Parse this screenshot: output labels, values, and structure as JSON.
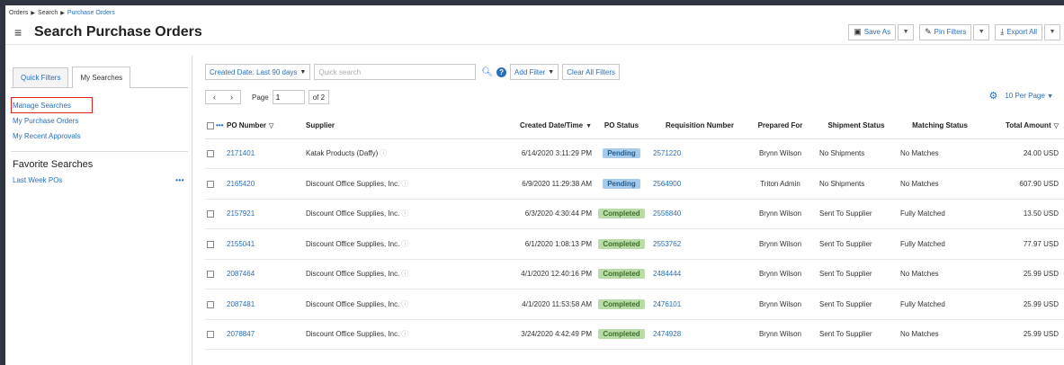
{
  "breadcrumb": [
    "Orders",
    "Search",
    "Purchase Orders"
  ],
  "header": {
    "title": "Search Purchase Orders",
    "save_as": "Save As",
    "pin_filters": "Pin Filters",
    "export_all": "Export All"
  },
  "sidebar": {
    "tabs": [
      "Quick Filters",
      "My Searches"
    ],
    "links": [
      "Manage Searches",
      "My Purchase Orders",
      "My Recent Approvals"
    ],
    "favorites_title": "Favorite Searches",
    "favorites": [
      "Last Week POs"
    ]
  },
  "filters": {
    "date_filter": "Created Date: Last 90 days",
    "search_placeholder": "Quick search",
    "add_filter": "Add Filter",
    "clear_all": "Clear All Filters"
  },
  "pager": {
    "page_label": "Page",
    "page_value": "1",
    "of": "of 2",
    "per_page": "10 Per Page"
  },
  "table": {
    "columns": [
      "PO Number",
      "Supplier",
      "Created Date/Time",
      "PO Status",
      "Requisition Number",
      "Prepared For",
      "Shipment Status",
      "Matching Status",
      "Total Amount"
    ],
    "rows": [
      {
        "po": "2171401",
        "supplier": "Katak Products (Daffy)",
        "date": "6/14/2020 3:11:29 PM",
        "status": "Pending",
        "req": "2571220",
        "prepared": "Brynn Wilson",
        "ship": "No Shipments",
        "match": "No Matches",
        "amount": "24.00 USD"
      },
      {
        "po": "2165420",
        "supplier": "Discount Office Supplies, Inc.",
        "date": "6/9/2020 11:29:38 AM",
        "status": "Pending",
        "req": "2564900",
        "prepared": "Triton Admin",
        "ship": "No Shipments",
        "match": "No Matches",
        "amount": "607.90 USD"
      },
      {
        "po": "2157921",
        "supplier": "Discount Office Supplies, Inc.",
        "date": "6/3/2020 4:30:44 PM",
        "status": "Completed",
        "req": "2556840",
        "prepared": "Brynn Wilson",
        "ship": "Sent To Supplier",
        "match": "Fully Matched",
        "amount": "13.50 USD"
      },
      {
        "po": "2155041",
        "supplier": "Discount Office Supplies, Inc.",
        "date": "6/1/2020 1:08:13 PM",
        "status": "Completed",
        "req": "2553762",
        "prepared": "Brynn Wilson",
        "ship": "Sent To Supplier",
        "match": "Fully Matched",
        "amount": "77.97 USD"
      },
      {
        "po": "2087464",
        "supplier": "Discount Office Supplies, Inc.",
        "date": "4/1/2020 12:40:16 PM",
        "status": "Completed",
        "req": "2484444",
        "prepared": "Brynn Wilson",
        "ship": "Sent To Supplier",
        "match": "No Matches",
        "amount": "25.99 USD"
      },
      {
        "po": "2087481",
        "supplier": "Discount Office Supplies, Inc.",
        "date": "4/1/2020 11:53:58 AM",
        "status": "Completed",
        "req": "2476101",
        "prepared": "Brynn Wilson",
        "ship": "Sent To Supplier",
        "match": "Fully Matched",
        "amount": "25.99 USD"
      },
      {
        "po": "2078847",
        "supplier": "Discount Office Supplies, Inc.",
        "date": "3/24/2020 4:42:49 PM",
        "status": "Completed",
        "req": "2474928",
        "prepared": "Brynn Wilson",
        "ship": "Sent To Supplier",
        "match": "No Matches",
        "amount": "25.99 USD"
      }
    ]
  },
  "colors": {
    "accent": "#2a6ebb",
    "pending_bg": "#a9cbea",
    "completed_bg": "#b9dba8",
    "highlight_border": "#dd2222"
  }
}
